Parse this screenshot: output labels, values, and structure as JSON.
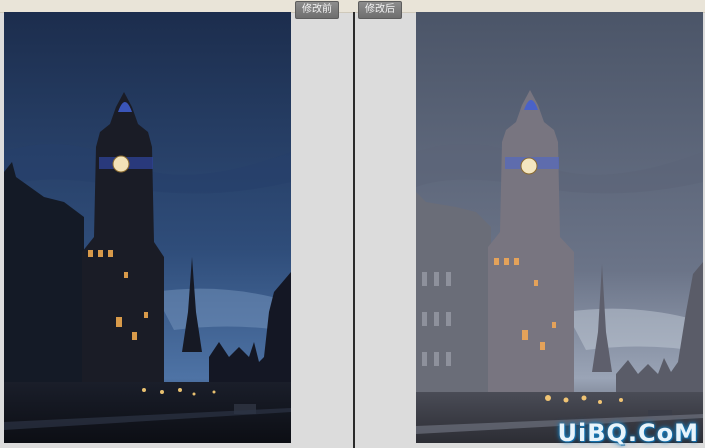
{
  "labels": {
    "before": "修改前",
    "after": "修改后"
  },
  "watermark": "UiBQ.CoM",
  "colors": {
    "sky_before_top": "#1f3357",
    "sky_before_bottom": "#3f6597",
    "sky_after_top": "#515b6e",
    "sky_after_bottom": "#8a93a4",
    "window_light": "#d89a4a",
    "clock_face": "#f2e2b8",
    "dome_light": "#3a55b8"
  },
  "icons": [
    "clock-tower-silhouette",
    "spire-silhouette"
  ]
}
